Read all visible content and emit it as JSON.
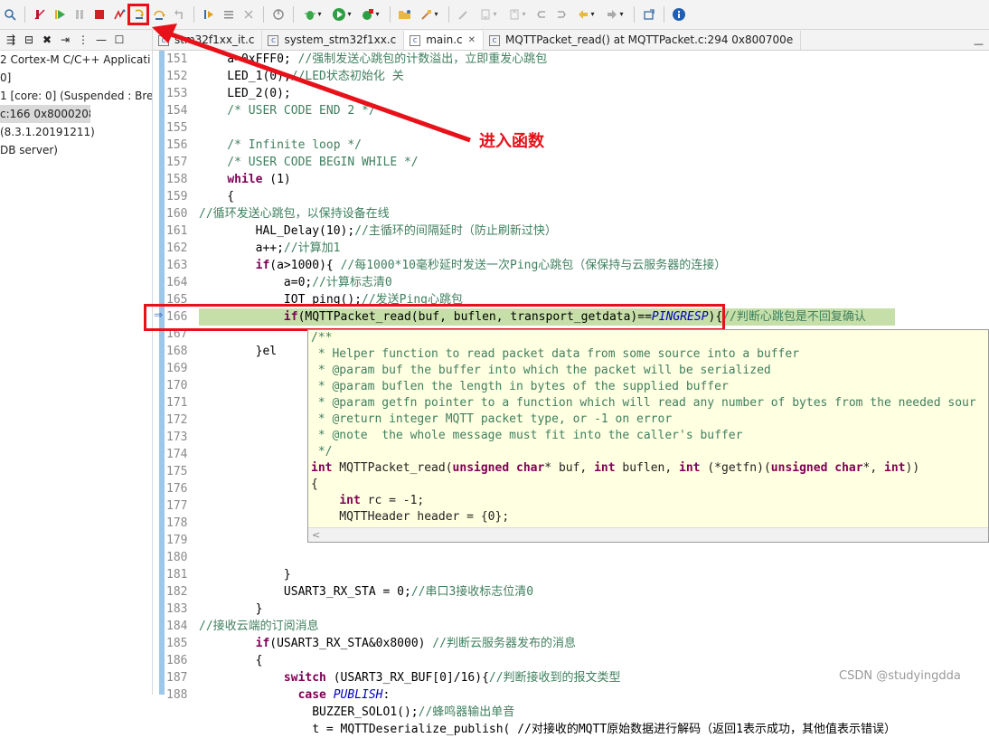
{
  "annotation": "进入函数",
  "watermark": "CSDN @studyingdda",
  "left_panel": {
    "items": [
      {
        "label": "2 Cortex-M C/C++ Applicati",
        "selected": false
      },
      {
        "label": "0]",
        "selected": false
      },
      {
        "label": "1 [core: 0] (Suspended : Bre",
        "selected": false
      },
      {
        "label": "c:166 0x8000208",
        "selected": true
      },
      {
        "label": "(8.3.1.20191211)",
        "selected": false
      },
      {
        "label": "DB server)",
        "selected": false
      }
    ]
  },
  "tabs": [
    {
      "label": "stm32f1xx_it.c",
      "active": false,
      "closable": false
    },
    {
      "label": "system_stm32f1xx.c",
      "active": false,
      "closable": false
    },
    {
      "label": "main.c",
      "active": true,
      "closable": true
    },
    {
      "label": "MQTTPacket_read() at MQTTPacket.c:294 0x800700e",
      "active": false,
      "closable": false
    }
  ],
  "line_numbers": [
    "151",
    "152",
    "153",
    "154",
    "155",
    "156",
    "157",
    "158",
    "159",
    "160",
    "161",
    "162",
    "163",
    "164",
    "165",
    "166",
    "167",
    "168",
    "169",
    "170",
    "171",
    "172",
    "173",
    "174",
    "175",
    "176",
    "177",
    "178",
    "179",
    "180",
    "181",
    "182",
    "183",
    "184",
    "185",
    "186",
    "187",
    "188"
  ],
  "code": {
    "l151a": "    a=0xFFF0; ",
    "l151b": "//强制发送心跳包的计数溢出，立即重发心跳包",
    "l152a": "    LED_1(0);",
    "l152b": "//LED状态初始化 关",
    "l153": "    LED_2(0);",
    "l154": "    /* USER CODE END 2 */",
    "l156": "    /* Infinite loop */",
    "l157": "    /* USER CODE BEGIN WHILE */",
    "l158kw": "while",
    "l158b": " (1)",
    "l159": "    {",
    "l160": "//循环发送心跳包，以保持设备在线",
    "l161a": "        HAL_Delay(10);",
    "l161b": "//主循环的间隔延时（防止刷新过快）",
    "l162a": "        a++;",
    "l162b": "//计算加1",
    "l163kw": "if",
    "l163a": "(a>1000){ ",
    "l163b": "//每1000*10毫秒延时发送一次Ping心跳包（保保持与云服务器的连接）",
    "l164a": "            a=0;",
    "l164b": "//计算标志清0",
    "l165a": "            IOT_ping();",
    "l165b": "//发送Ping心跳包",
    "l166kw": "if",
    "l166a": "(MQTTPacket_read(buf, buflen, transport_getdata)==",
    "l166it": "PINGRESP",
    "l166b": "){",
    "l166c": "//判断心跳包是不回复确认",
    "l168": "        }el",
    "l179": "            }",
    "l180a": "            USART3_RX_STA = 0;",
    "l180b": "//串口3接收标志位清0",
    "l181": "        }",
    "l182": "//接收云端的订阅消息",
    "l183kw": "if",
    "l183a": "(USART3_RX_STA&0x8000) ",
    "l183b": "//判断云服务器发布的消息",
    "l184": "        {",
    "l185kw": "switch",
    "l185a": " (USART3_RX_BUF[0]/16){",
    "l185b": "//判断接收到的报文类型",
    "l186kw": "case",
    "l186it": "PUBLISH",
    "l186b": ":",
    "l187a": "                BUZZER_SOLO1();",
    "l187b": "//蜂鸣器输出单音",
    "l188": "                t = MQTTDeserialize_publish( //对接收的MQTT原始数据进行解码（返回1表示成功，其他值表示错误）"
  },
  "hover": {
    "lines": [
      "/**",
      " * Helper function to read packet data from some source into a buffer",
      " * @param buf the buffer into which the packet will be serialized",
      " * @param buflen the length in bytes of the supplied buffer",
      " * @param getfn pointer to a function which will read any number of bytes from the needed sour",
      " * @return integer MQTT packet type, or -1 on error",
      " * @note  the whole message must fit into the caller's buffer",
      " */"
    ],
    "sig_kw1": "int",
    "sig_name": " MQTTPacket_read(",
    "sig_kw2": "unsigned char",
    "sig_a": "* buf, ",
    "sig_kw3": "int",
    "sig_b": " buflen, ",
    "sig_kw4": "int",
    "sig_c": " (*getfn)(",
    "sig_kw5": "unsigned char",
    "sig_d": "*, ",
    "sig_kw6": "int",
    "sig_e": "))",
    "brace": "{",
    "rc_kw": "int",
    "rc": " rc = -1;",
    "header": "    MQTTHeader header = {0};",
    "scroll_left": "<"
  }
}
